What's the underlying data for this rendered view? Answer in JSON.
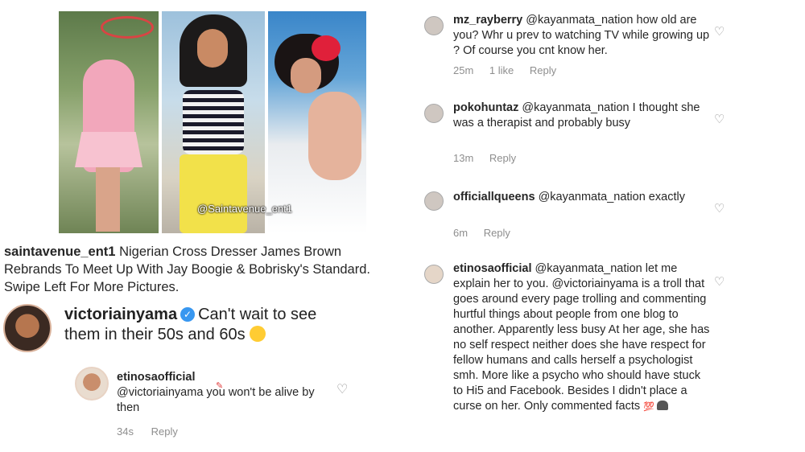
{
  "post": {
    "watermark": "@Saintavenue_ent1",
    "caption_user": "saintavenue_ent1",
    "caption_text": "Nigerian Cross Dresser James Brown Rebrands To Meet Up With Jay Boogie & Bobrisky's Standard. Swipe Left For More Pictures."
  },
  "main_comment": {
    "user": "victoriainyama",
    "text": "Can't wait to see them in their 50s and 60s"
  },
  "reply_left": {
    "user": "etinosaofficial",
    "text": "@victoriainyama you won't be alive by then",
    "time": "34s",
    "reply_label": "Reply"
  },
  "comments": [
    {
      "user": "mz_rayberry",
      "text": "@kayanmata_nation how old are you? Whr u prev to watching TV while growing up ? Of course you cnt know her.",
      "time": "25m",
      "likes": "1 like",
      "reply_label": "Reply"
    },
    {
      "user": "pokohuntaz",
      "text": "@kayanmata_nation I thought she was a therapist and probably busy",
      "time": "13m",
      "reply_label": "Reply"
    },
    {
      "user": "officiallqueens",
      "text": "@kayanmata_nation exactly",
      "time": "6m",
      "reply_label": "Reply"
    },
    {
      "user": "etinosaofficial",
      "text": "@kayanmata_nation let me explain her to you. @victoriainyama is a troll that goes around every page trolling and commenting hurtful things about people from one blog to another. Apparently less busy At her age, she has no self respect neither does she have respect for fellow humans and calls herself a psychologist smh. More like a psycho who should have stuck to Hi5 and Facebook. Besides I didn't place a curse on her. Only commented facts"
    }
  ],
  "icons": {
    "heart": "heart-outline-icon",
    "verified": "verified-badge-icon"
  },
  "colors": {
    "meta_gray": "#8e8e8e",
    "verified_blue": "#3897f0"
  }
}
